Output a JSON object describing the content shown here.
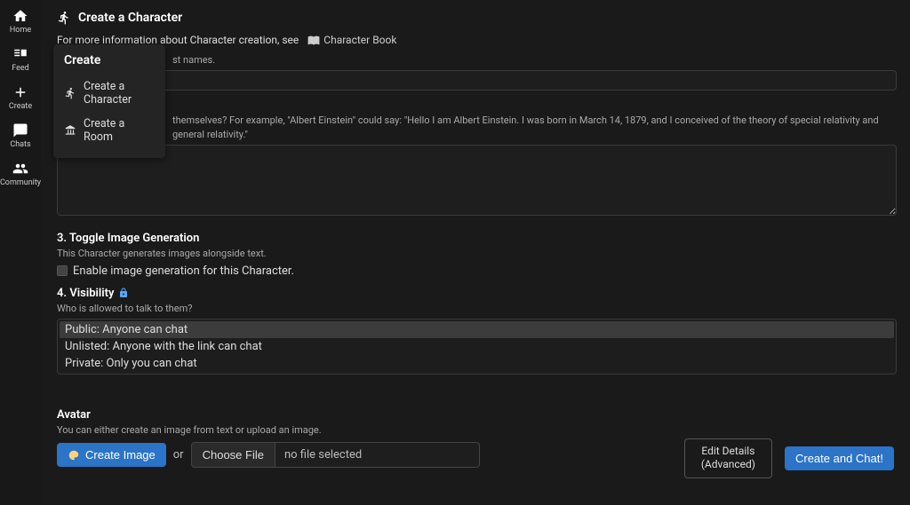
{
  "sidebar": {
    "items": [
      {
        "label": "Home"
      },
      {
        "label": "Feed"
      },
      {
        "label": "Create"
      },
      {
        "label": "Chats"
      },
      {
        "label": "Community"
      }
    ]
  },
  "page": {
    "title": "Create a Character",
    "info_prefix": "For more information about Character creation, see",
    "book_label": "Character Book"
  },
  "name": {
    "hint_suffix": "st names."
  },
  "greeting": {
    "hint_visible": "themselves? For example, \"Albert Einstein\" could say: \"Hello I am Albert Einstein. I was born in March 14, 1879, and I conceived of the theory of special relativity and general relativity.\""
  },
  "image_gen": {
    "heading": "3. Toggle Image Generation",
    "hint": "This Character generates images alongside text.",
    "checkbox_label": "Enable image generation for this Character."
  },
  "visibility": {
    "heading": "4. Visibility",
    "hint": "Who is allowed to talk to them?",
    "options": [
      "Public: Anyone can chat",
      "Unlisted: Anyone with the link can chat",
      "Private: Only you can chat"
    ]
  },
  "avatar": {
    "heading": "Avatar",
    "hint": "You can either create an image from text or upload an image.",
    "create_label": "Create Image",
    "or_label": "or",
    "choose_label": "Choose File",
    "no_file": "no file selected"
  },
  "footer": {
    "edit_line1": "Edit Details",
    "edit_line2": "(Advanced)",
    "create_chat": "Create and Chat!"
  },
  "popover": {
    "title": "Create",
    "items": [
      "Create a Character",
      "Create a Room"
    ]
  }
}
